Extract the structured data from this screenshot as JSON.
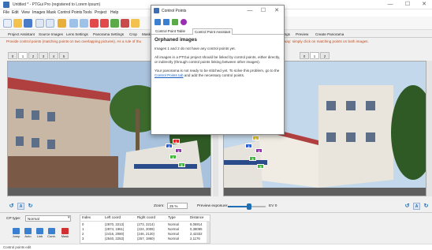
{
  "window": {
    "title": "Untitled * - PTGui Pro (registered to Lorem Ipsum)",
    "minimize": "—",
    "maximize": "☐",
    "close": "✕"
  },
  "menu": [
    "File",
    "Edit",
    "View",
    "Images",
    "Mask",
    "Control Points",
    "Tools",
    "Project",
    "Help"
  ],
  "main_tabs": [
    "Project Assistant",
    "Source Images",
    "Lens Settings",
    "Panorama Settings",
    "Crop",
    "Mask"
  ],
  "main_tabs_right": [
    "ttings",
    "Preview",
    "Create Panorama"
  ],
  "active_main_tab": "Control Points",
  "hint": "Provide control points (matching points on two overlapping pictures). As a rule of thu",
  "hint_right": "way: simply click on matching points on both images.",
  "image_tabs_left": [
    "0",
    "1",
    "2",
    "3",
    "4",
    "5"
  ],
  "image_tabs_right": [
    "0",
    "1",
    "2"
  ],
  "zoom": {
    "label": "Zoom:",
    "value": "25 %"
  },
  "preview_exposure": {
    "label": "Preview exposure:",
    "value": "EV 0"
  },
  "cp_type": {
    "label": "CP type:",
    "value": "Normal"
  },
  "action_buttons": [
    {
      "label": "Jump",
      "icon": "jump-icon"
    },
    {
      "label": "Auto",
      "icon": "auto-icon"
    },
    {
      "label": "Link",
      "icon": "link-icon"
    },
    {
      "label": "Contr.",
      "icon": "control-icon"
    },
    {
      "label": "Mask",
      "icon": "mask-icon"
    }
  ],
  "table": {
    "headers": [
      "Index",
      "Left coord",
      "Right coord",
      "Type",
      "Distance"
    ],
    "rows": [
      [
        "0",
        "(2870, 2213)",
        "(273, 2214)",
        "Normal",
        "8,06914"
      ],
      [
        "1",
        "(2874, 1961)",
        "(224, 2009)",
        "Normal",
        "0,38095"
      ],
      [
        "2",
        "(2416, 2080)",
        "(246, 2120)",
        "Normal",
        "2,42332"
      ],
      [
        "3",
        "(2540, 2253)",
        "(257, 1960)",
        "Normal",
        "2,1176"
      ]
    ]
  },
  "status": "Control points edit",
  "dialog": {
    "title": "Control Points",
    "tabs": [
      "Control Point Table",
      "Control Point Assistant"
    ],
    "active_tab": "Control Point Assistant",
    "heading": "Orphaned images",
    "para1": "Images 1 and 2 do not have any control points yet.",
    "para2": "All images in a PTGui project should be linked by control points, either directly, or indirectly (through control points linking between other images).",
    "para3_pre": "Your panorama is not ready to be stitched yet. To solve this problem, go to the ",
    "para3_link": "Control Points tab",
    "para3_post": " and add the necessary control points."
  },
  "colors": {
    "accent": "#1f6fb5",
    "hint": "#c04a1a",
    "cp_red": "#e0262b",
    "cp_blue": "#2a5fd6",
    "cp_purple": "#9a2fb3",
    "cp_green": "#3fb83a",
    "cp_yellow": "#e2c21b"
  }
}
